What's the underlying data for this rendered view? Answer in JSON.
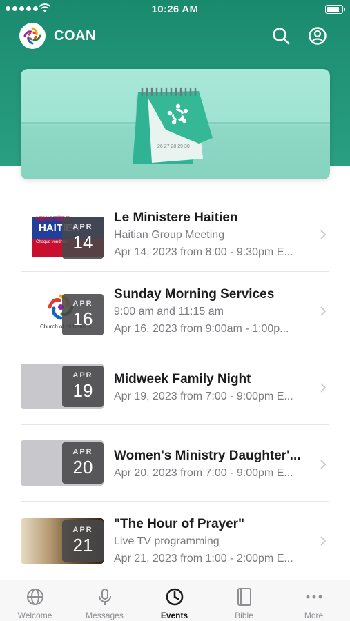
{
  "status_bar": {
    "time": "10:26 AM"
  },
  "header": {
    "title": "COAN",
    "search_icon": "search-icon",
    "profile_icon": "person-circle-icon"
  },
  "hero": {
    "icon": "calendar-illustration",
    "calendar_numbers": "26 27 28 29 30"
  },
  "events": [
    {
      "title": "Le Ministere Haitien",
      "subtitle": "Haitian Group Meeting",
      "detail": "Apr 14, 2023 from 8:00 - 9:30pm E...",
      "month": "APR",
      "day": "14",
      "thumb_text_top": "MINISTÈRE",
      "thumb_text_main": "HAITIEN",
      "thumb_text_small": "Chaque vendredi"
    },
    {
      "title": "Sunday Morning Services",
      "subtitle": "9:00 am and 11:15 am",
      "detail": "Apr 16, 2023 from 9:00am - 1:00p...",
      "month": "APR",
      "day": "16",
      "thumb_text_main": "Church of all Nations"
    },
    {
      "title": "Midweek Family Night",
      "subtitle": "Apr 19, 2023 from 7:00 - 9:00pm E...",
      "month": "APR",
      "day": "19"
    },
    {
      "title": "Women's Ministry Daughter'...",
      "subtitle": "Apr 20, 2023 from 7:00 - 9:00pm E...",
      "month": "APR",
      "day": "20"
    },
    {
      "title": "\"The Hour of Prayer\"",
      "subtitle": "Live TV programming",
      "detail": "Apr 21, 2023 from 1:00 - 2:00pm E...",
      "month": "APR",
      "day": "21"
    }
  ],
  "tabs": [
    {
      "label": "Welcome",
      "icon": "globe-icon"
    },
    {
      "label": "Messages",
      "icon": "microphone-icon"
    },
    {
      "label": "Events",
      "icon": "clock-icon",
      "active": true
    },
    {
      "label": "Bible",
      "icon": "book-icon"
    },
    {
      "label": "More",
      "icon": "more-icon"
    }
  ],
  "colors": {
    "brand": "#1a8a6e",
    "hero": "#a9e8d8",
    "calendar": "#2fb394"
  }
}
